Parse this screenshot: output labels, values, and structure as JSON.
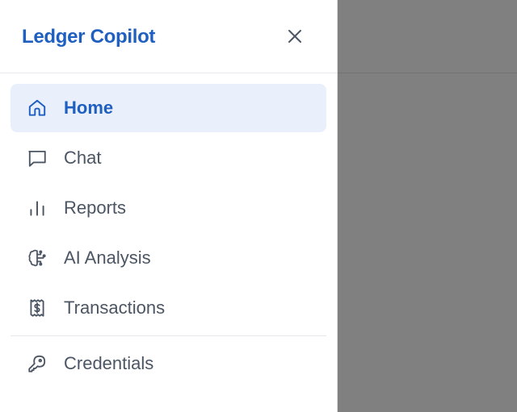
{
  "app": {
    "brand": "Ledger Copilot",
    "accent_color": "#1f5fbf",
    "active_bg": "#e9f0fb",
    "overlay_color": "#808080"
  },
  "drawer": {
    "close_icon": "close-icon",
    "nav_items": [
      {
        "label": "Home",
        "icon": "home-icon",
        "active": true
      },
      {
        "label": "Chat",
        "icon": "chat-bubble-icon",
        "active": false
      },
      {
        "label": "Reports",
        "icon": "bar-chart-icon",
        "active": false
      },
      {
        "label": "AI Analysis",
        "icon": "brain-icon",
        "active": false
      },
      {
        "label": "Transactions",
        "icon": "receipt-icon",
        "active": false
      }
    ],
    "secondary_items": [
      {
        "label": "Credentials",
        "icon": "key-icon",
        "active": false
      }
    ]
  }
}
